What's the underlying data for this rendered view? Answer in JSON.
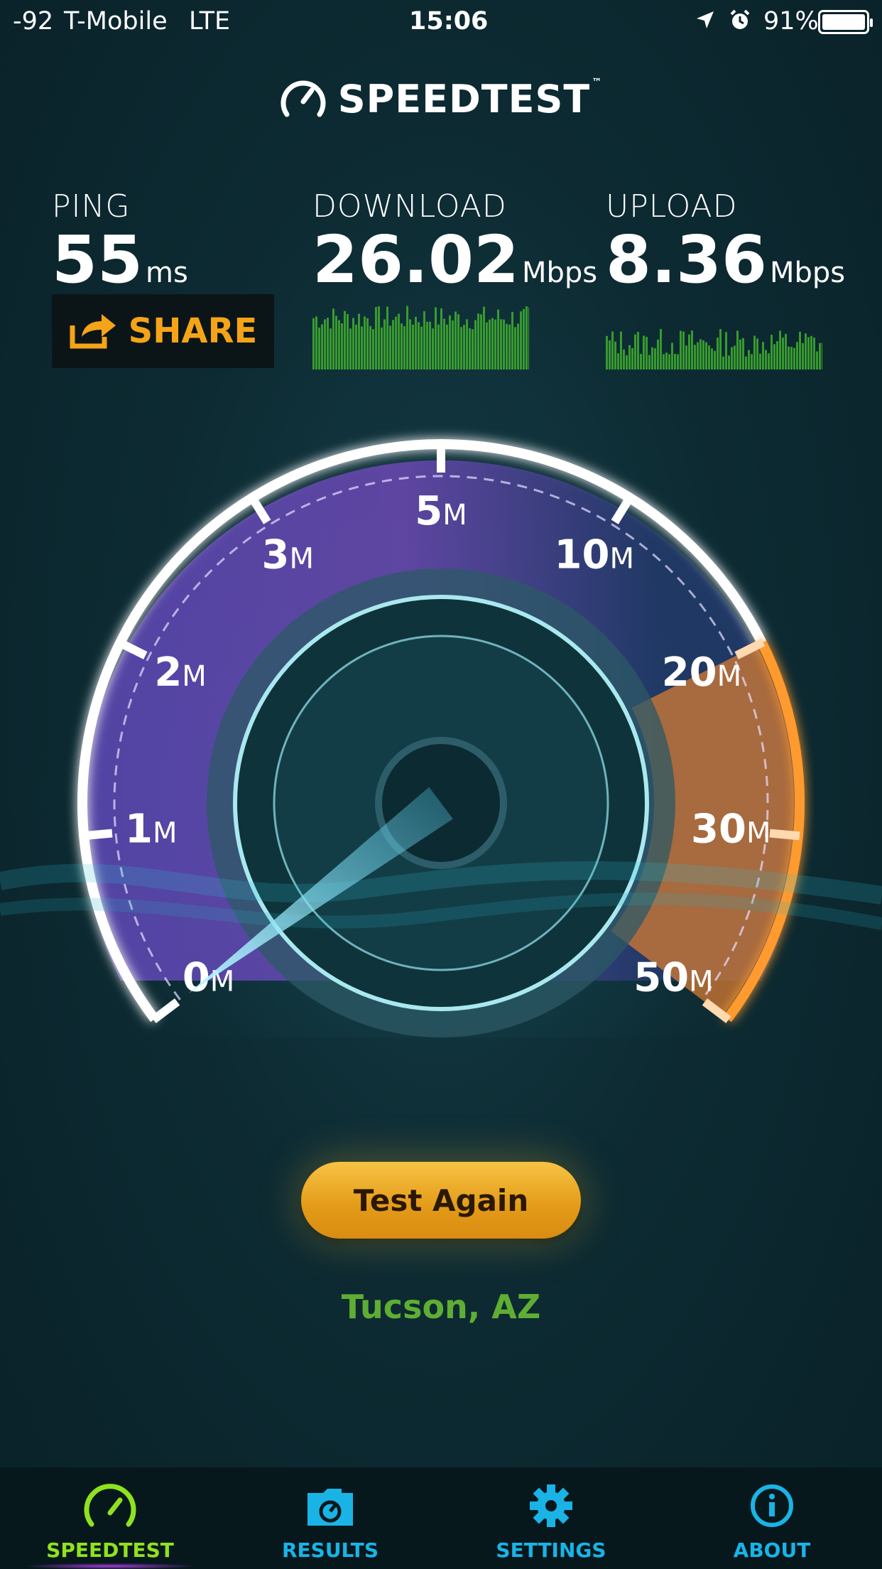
{
  "status_bar": {
    "signal": "-92",
    "carrier": "T-Mobile",
    "network": "LTE",
    "time": "15:06",
    "battery": "91%"
  },
  "app": {
    "name": "SPEEDTEST",
    "tm": "™"
  },
  "ping": {
    "label": "PING",
    "value": "55",
    "unit": "ms"
  },
  "download": {
    "label": "DOWNLOAD",
    "value": "26.02",
    "unit": "Mbps"
  },
  "upload": {
    "label": "UPLOAD",
    "value": "8.36",
    "unit": "Mbps"
  },
  "share": {
    "label": "SHARE"
  },
  "gauge": {
    "ticks": [
      "0",
      "1",
      "2",
      "3",
      "5",
      "10",
      "20",
      "30",
      "50"
    ],
    "unit": "M",
    "needle_value_mbps": 0
  },
  "test_again": {
    "label": "Test Again"
  },
  "location": "Tucson, AZ",
  "tabs": [
    {
      "label": "SPEEDTEST",
      "icon": "speedometer-icon",
      "active": true
    },
    {
      "label": "RESULTS",
      "icon": "results-folder-icon",
      "active": false
    },
    {
      "label": "SETTINGS",
      "icon": "gear-icon",
      "active": false
    },
    {
      "label": "ABOUT",
      "icon": "info-icon",
      "active": false
    }
  ],
  "colors": {
    "accent_orange": "#f5a417",
    "accent_green": "#8ee21f",
    "tab_blue": "#1ab3e6",
    "location_green": "#5fae33"
  }
}
